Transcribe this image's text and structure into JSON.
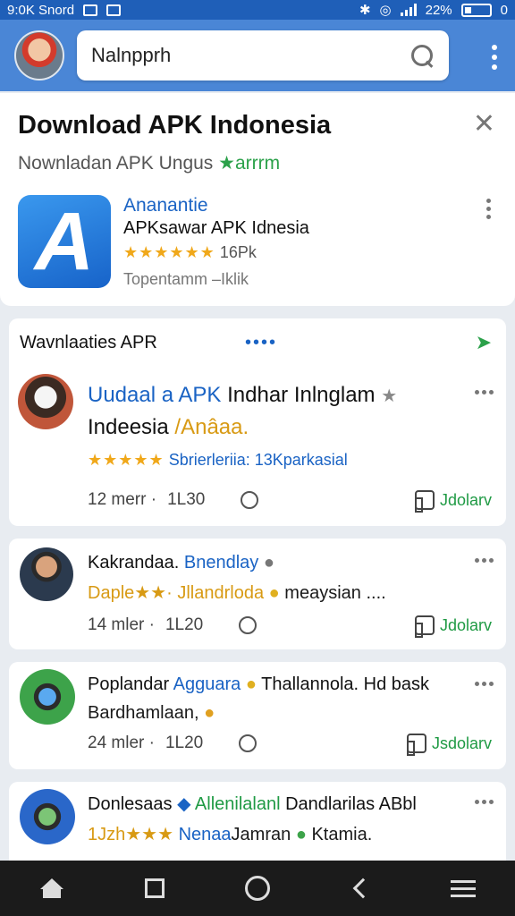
{
  "status_bar": {
    "left_text": "9:0K Snord",
    "battery_text": "22%",
    "battery_tail": "0"
  },
  "search": {
    "value": "Nalnpprh"
  },
  "featured": {
    "title": "Download APK Indonesia",
    "subtitle": "Nownladan APK Ungus",
    "subtitle_accent": "★arrrm",
    "app_icon_letter": "A",
    "app_name": "Ananantie",
    "app_desc": "APKsawar APK Idnesia",
    "rating_stars": "★★★★★★",
    "rating_count": "16Pk",
    "meta": "Topentamm –Iklik"
  },
  "feed": {
    "header": "Wavnlaaties APR",
    "header_dots": "••••",
    "share_icon": "➤",
    "post": {
      "title_blue": "Uudaal a APK",
      "title_black": "Indhar Inlnglam",
      "title_line2_black": "Indeesia",
      "title_line2_gold": "/Anâaa.",
      "stars": "★★★★★",
      "rating_text": "Sbrierleriia: 13Kparkasial",
      "time": "12 merr ·",
      "count": "1L30",
      "like_label": "Jdolarv"
    }
  },
  "cards": [
    {
      "name_black": "Kakrandaa.",
      "name_blue": "Bnendlay",
      "line2_gold": "Daple★★·",
      "line2_text": "Jllandrloda",
      "line2_end": "meaysian ....",
      "time": "14 mler ·",
      "count": "1L20",
      "like_label": "Jdolarv"
    },
    {
      "name_black": "Poplandar",
      "name_blue": "Agguara",
      "name_end": "Thallannola. Hd bask",
      "line2_text": "Bardhamlaan,",
      "time": "24 mler ·",
      "count": "1L20",
      "like_label": "Jsdolarv"
    },
    {
      "name_black": "Donlesaas",
      "name_green": "Allenilalanl",
      "name_end": "Dandlarilas ABbl",
      "line2_gold": "1Jzh★★★",
      "line2_blue": "Nenaa",
      "line2_text": "Jamran",
      "line2_end": "Ktamia."
    }
  ]
}
